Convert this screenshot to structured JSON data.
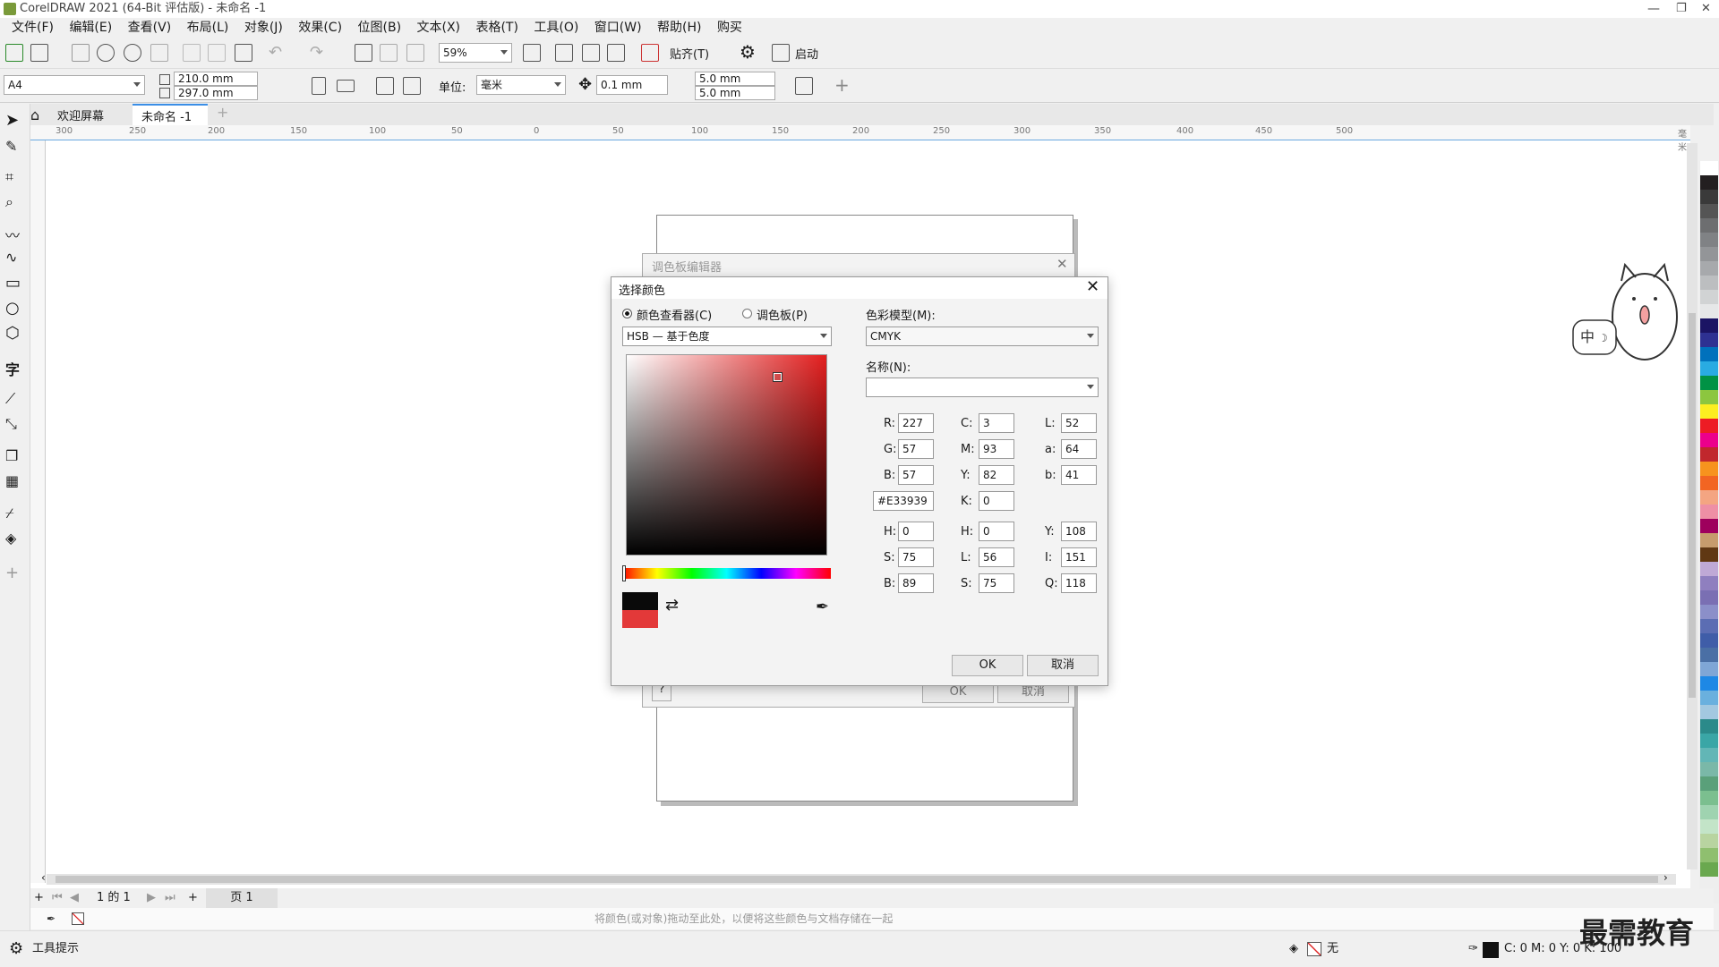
{
  "app": {
    "title": "CorelDRAW 2021 (64-Bit 评估版) - 未命名 -1"
  },
  "menu": [
    "文件(F)",
    "编辑(E)",
    "查看(V)",
    "布局(L)",
    "对象(J)",
    "效果(C)",
    "位图(B)",
    "文本(X)",
    "表格(T)",
    "工具(O)",
    "窗口(W)",
    "帮助(H)",
    "购买"
  ],
  "toolbar1": {
    "zoom": "59%",
    "snap_label": "贴齐(T)",
    "launch_label": "启动"
  },
  "toolbar2": {
    "page_size": "A4",
    "width": "210.0 mm",
    "height": "297.0 mm",
    "unit_label": "单位:",
    "unit": "毫米",
    "nudge": "0.1 mm",
    "dup_x": "5.0 mm",
    "dup_y": "5.0 mm"
  },
  "tabs": {
    "welcome": "欢迎屏幕",
    "doc": "未命名 -1"
  },
  "ruler": [
    "300",
    "250",
    "200",
    "150",
    "100",
    "50",
    "0",
    "50",
    "100",
    "150",
    "200",
    "250",
    "300",
    "350",
    "400",
    "450",
    "500"
  ],
  "ruler_unit": "毫米",
  "palette_editor": {
    "title": "调色板编辑器",
    "ok": "OK",
    "cancel": "取消"
  },
  "dialog": {
    "title": "选择颜色",
    "radio_viewer": "颜色查看器(C)",
    "radio_palette": "调色板(P)",
    "mode": "HSB — 基于色度",
    "model_label": "色彩模型(M):",
    "model": "CMYK",
    "name_label": "名称(N):",
    "name_value": "",
    "rgb": {
      "R": "227",
      "G": "57",
      "B": "57"
    },
    "cmyk": {
      "C": "3",
      "M": "93",
      "Y": "82",
      "K": "0"
    },
    "lab": {
      "L": "52",
      "a": "64",
      "b": "41"
    },
    "hex": "#E33939",
    "hsb": {
      "H": "0",
      "S": "75",
      "B": "89"
    },
    "hls": {
      "H": "0",
      "L": "56",
      "S": "75"
    },
    "yiq": {
      "Y": "108",
      "I": "151",
      "Q": "118"
    },
    "ok": "OK",
    "cancel": "取消",
    "old_color": "#0a0a0a",
    "new_color": "#e33939"
  },
  "pagebar": {
    "page_of": "1 的 1",
    "page_tab": "页 1"
  },
  "colorbar_hint": "将颜色(或对象)拖动至此处，以便将这些颜色与文档存储在一起",
  "status": {
    "hint": "工具提示",
    "fill": "无",
    "outline": "C: 0 M: 0 Y: 0 K: 100"
  },
  "palette_colors": [
    "#fff",
    "#231f20",
    "#3a3a3a",
    "#555",
    "#6d6e70",
    "#808285",
    "#939598",
    "#a7a9ac",
    "#bcbec0",
    "#d1d3d4",
    "#e6e7e8",
    "#1b1464",
    "#2e3192",
    "#0071bc",
    "#29abe2",
    "#009245",
    "#8cc63f",
    "#fcee21",
    "#ed1c24",
    "#ec008c",
    "#c1272d",
    "#f7931e",
    "#f26522",
    "#f4a582",
    "#ee8fa5",
    "#9e005d",
    "#c69c6d",
    "#603813",
    "#bfa9d6",
    "#8f7fbf",
    "#7a6fb3",
    "#8b8fc9",
    "#5b6db3",
    "#3f5da8",
    "#4a6fa5",
    "#7fa6d6",
    "#1e88e5",
    "#6ab0de",
    "#a3c8e0",
    "#2b8a8a",
    "#3aa6a6",
    "#62b6b6",
    "#7ab8a8",
    "#5aa07a",
    "#7bbf8f",
    "#9fd3b0",
    "#c3e4c8",
    "#b8d4a0",
    "#8fbf6f",
    "#6aa84f"
  ],
  "watermark": "最需教育"
}
